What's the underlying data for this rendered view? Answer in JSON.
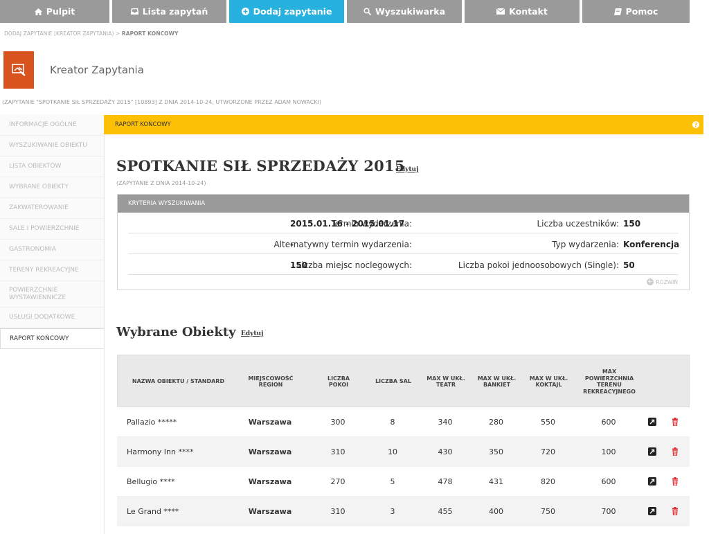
{
  "nav": [
    {
      "label": "Pulpit",
      "icon": "home-icon",
      "active": false
    },
    {
      "label": "Lista zapytań",
      "icon": "inbox-icon",
      "active": false
    },
    {
      "label": "Dodaj zapytanie",
      "icon": "plus-circle-icon",
      "active": true
    },
    {
      "label": "Wyszukiwarka",
      "icon": "search-icon",
      "active": false
    },
    {
      "label": "Kontakt",
      "icon": "envelope-icon",
      "active": false
    },
    {
      "label": "Pomoc",
      "icon": "book-icon",
      "active": false
    }
  ],
  "breadcrumb": {
    "path": "DODAJ ZAPYTANIE (KREATOR ZAPYTANIA) > ",
    "current": "RAPORT KOŃCOWY"
  },
  "page": {
    "title": "Kreator Zapytania",
    "info": "(ZAPYTANIE \"SPOTKANIE SIŁ SPRZEDAŻY 2015\" [10893] Z DNIA 2014-10-24, UTWORZONE PRZEZ ADAM NOWACKI)"
  },
  "sidebar": [
    {
      "label": "INFORMACJE OGÓLNE"
    },
    {
      "label": "WYSZUKIWANIE OBIEKTU"
    },
    {
      "label": "LISTA OBIEKTÓW"
    },
    {
      "label": "WYBRANE OBIEKTY"
    },
    {
      "label": "ZAKWATEROWANIE"
    },
    {
      "label": "SALE I POWIERZCHNIE"
    },
    {
      "label": "GASTRONOMIA"
    },
    {
      "label": "TERENY REKREACYJNE"
    },
    {
      "label": "POWIERZCHNIE WYSTAWIENNICZE"
    },
    {
      "label": "USŁUGI DODATKOWE"
    },
    {
      "label": "RAPORT KOŃCOWY"
    }
  ],
  "section_bar": {
    "label": "RAPORT KOŃCOWY",
    "help": "?"
  },
  "event": {
    "title": "SPOTKANIE SIŁ SPRZEDAŻY 2015",
    "edit": "Edytuj",
    "subtitle": "(ZAPYTANIE Z DNIA 2014-10-24)"
  },
  "criteria": {
    "header": "KRYTERIA WYSZUKIWANIA",
    "rows": [
      {
        "left_label": "Termin wydarzenia:",
        "left_value": "2015.01.16 - 2015.01.17",
        "right_label": "Liczba uczestników:",
        "right_value": "150"
      },
      {
        "left_label": "Alternatywny termin wydarzenia:",
        "left_value": "-",
        "right_label": "Typ wydarzenia:",
        "right_value": "Konferencja"
      },
      {
        "left_label": "Liczba miejsc noclegowych:",
        "left_value": "150",
        "right_label": "Liczba pokoi jednoosobowych (Single):",
        "right_value": "50"
      }
    ],
    "expand": "ROZWIŃ"
  },
  "selected": {
    "title": "Wybrane Obiekty",
    "edit": "Edytuj",
    "columns": [
      "NAZWA OBIEKTU / STANDARD",
      "MIEJSCOWOŚĆ REGION",
      "LICZBA POKOI",
      "LICZBA SAL",
      "MAX W UKŁ. TEATR",
      "MAX W UKŁ. BANKIET",
      "MAX W UKŁ. KOKTAJL",
      "MAX POWIERZCHNIA TERENU REKREACYJNEGO"
    ],
    "rows": [
      [
        "Pallazio *****",
        "Warszawa",
        "300",
        "8",
        "340",
        "280",
        "550",
        "600"
      ],
      [
        "Harmony Inn ****",
        "Warszawa",
        "310",
        "10",
        "430",
        "350",
        "720",
        "100"
      ],
      [
        "Bellugio ****",
        "Warszawa",
        "270",
        "5",
        "478",
        "431",
        "820",
        "600"
      ],
      [
        "Le Grand ****",
        "Warszawa",
        "310",
        "3",
        "455",
        "400",
        "750",
        "700"
      ]
    ]
  },
  "colors": {
    "active_nav": "#27b1de",
    "nav": "#9a9a9a",
    "accent_orange": "#d9531e",
    "section_bar": "#fcc106",
    "delete": "#e0282d"
  }
}
